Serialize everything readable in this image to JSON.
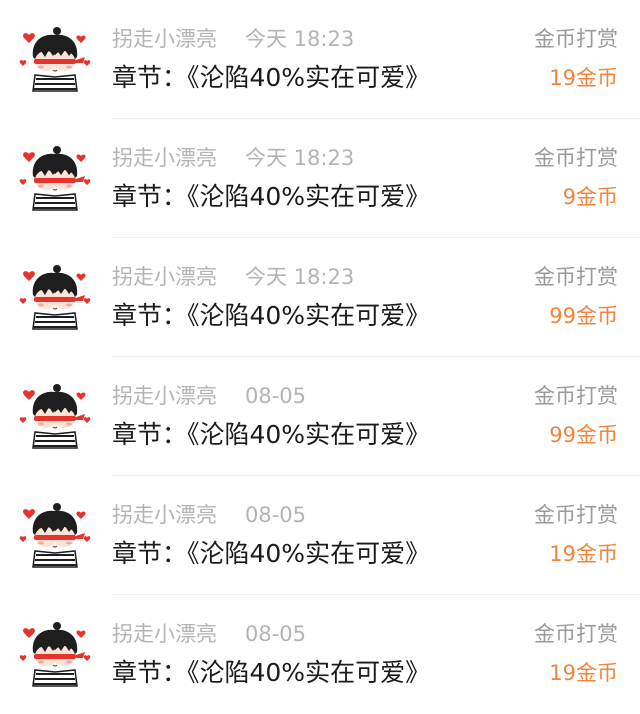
{
  "rows": [
    {
      "user": "拐走小漂亮",
      "time": "今天 18:23",
      "chapter": "章节：《沦陷40%实在可爱》",
      "tip_label": "金币打赏",
      "amount": "19金币"
    },
    {
      "user": "拐走小漂亮",
      "time": "今天 18:23",
      "chapter": "章节：《沦陷40%实在可爱》",
      "tip_label": "金币打赏",
      "amount": "9金币"
    },
    {
      "user": "拐走小漂亮",
      "time": "今天 18:23",
      "chapter": "章节：《沦陷40%实在可爱》",
      "tip_label": "金币打赏",
      "amount": "99金币"
    },
    {
      "user": "拐走小漂亮",
      "time": "08-05",
      "chapter": "章节：《沦陷40%实在可爱》",
      "tip_label": "金币打赏",
      "amount": "99金币"
    },
    {
      "user": "拐走小漂亮",
      "time": "08-05",
      "chapter": "章节：《沦陷40%实在可爱》",
      "tip_label": "金币打赏",
      "amount": "19金币"
    },
    {
      "user": "拐走小漂亮",
      "time": "08-05",
      "chapter": "章节：《沦陷40%实在可爱》",
      "tip_label": "金币打赏",
      "amount": "19金币"
    }
  ],
  "colors": {
    "amount": "#f2853a",
    "muted": "#b4b4b4",
    "label": "#9a9a9a",
    "text": "#1a1a1a",
    "heart": "#e5342c"
  },
  "icons": {
    "avatar": "cartoon-couple-avatar-icon"
  }
}
